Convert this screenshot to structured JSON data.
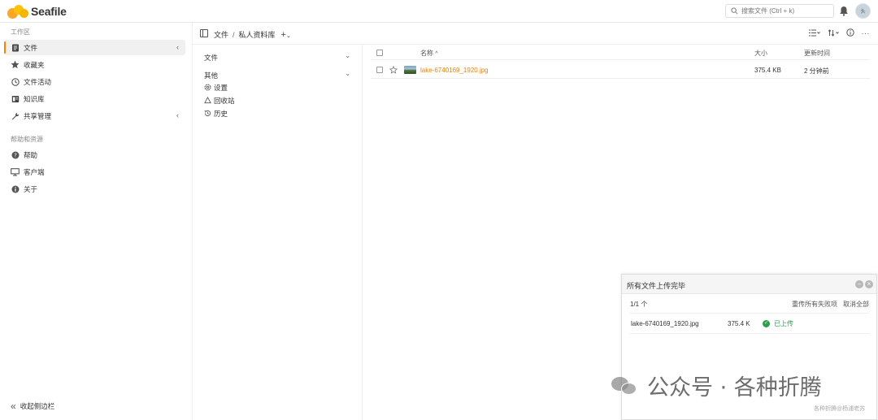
{
  "header": {
    "brand": "Seafile",
    "search_placeholder": "搜索文件 (Ctrl + k)",
    "avatar_text": "头"
  },
  "sidebar": {
    "workspace_title": "工作区",
    "workspace_items": [
      {
        "label": "文件",
        "icon": "file-icon",
        "active": true
      },
      {
        "label": "收藏夹",
        "icon": "star-icon"
      },
      {
        "label": "文件活动",
        "icon": "clock-icon"
      },
      {
        "label": "知识库",
        "icon": "wiki-icon"
      },
      {
        "label": "共享管理",
        "icon": "wrench-icon"
      }
    ],
    "help_title": "帮助和资源",
    "help_items": [
      {
        "label": "帮助",
        "icon": "help-icon"
      },
      {
        "label": "客户端",
        "icon": "monitor-icon"
      },
      {
        "label": "关于",
        "icon": "info-icon"
      }
    ],
    "collapse_label": "收起侧边栏"
  },
  "pathbar": {
    "root": "文件",
    "separator": "/",
    "library": "私人资料库"
  },
  "tree": {
    "files_label": "文件",
    "other_label": "其他",
    "other_items": [
      {
        "label": "设置",
        "icon": "settings-icon"
      },
      {
        "label": "回收站",
        "icon": "trash-icon"
      },
      {
        "label": "历史",
        "icon": "history-icon"
      }
    ]
  },
  "file_list": {
    "columns": {
      "name": "名称",
      "size": "大小",
      "modified": "更新时间"
    },
    "rows": [
      {
        "name": "lake-6740169_1920.jpg",
        "size": "375.4 KB",
        "modified": "2 分钟前"
      }
    ]
  },
  "upload": {
    "title": "所有文件上传完毕",
    "count": "1/1 个",
    "retry_label": "重传所有失败项",
    "cancel_label": "取消全部",
    "files": [
      {
        "name": "lake-6740169_1920.jpg",
        "size": "375.4 K",
        "status": "已上传"
      }
    ]
  },
  "watermark": {
    "main": "公众号 · 各种折腾",
    "sub": "各种折腾@杨浦老苏"
  },
  "colors": {
    "accent": "#ff8000",
    "file_link": "#eb8205",
    "success": "#2e9e4a"
  }
}
